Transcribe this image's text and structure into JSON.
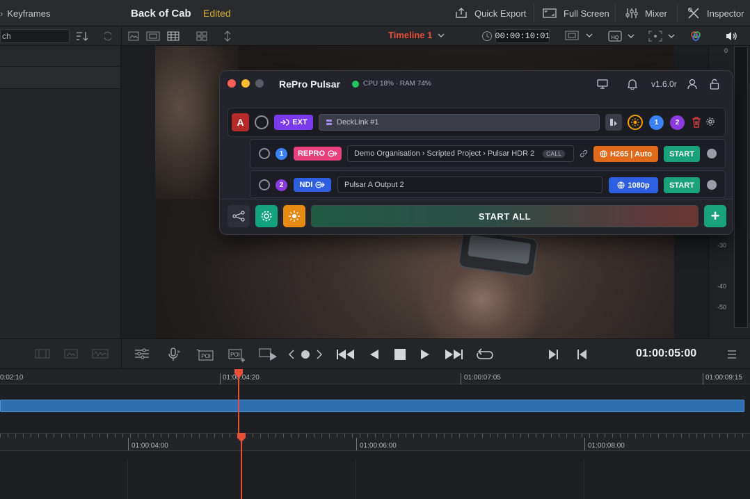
{
  "topbar": {
    "keyframes": "Keyframes",
    "project_title": "Back of Cab",
    "edited": "Edited",
    "quick_export": "Quick Export",
    "full_screen": "Full Screen",
    "mixer": "Mixer",
    "inspector": "Inspector"
  },
  "toolbar2": {
    "search_placeholder": "ch",
    "timeline_name": "Timeline 1",
    "timecode": "00:00:10:01"
  },
  "meter": {
    "ticks": [
      "0",
      "-30",
      "-40",
      "-50"
    ]
  },
  "pulsar": {
    "title": "RePro Pulsar",
    "status": "CPU 18% · RAM 74%",
    "version": "v1.6.0r",
    "source": {
      "badge": "A",
      "type": "EXT",
      "device": "DeckLink #1",
      "output_badges": [
        "1",
        "2"
      ]
    },
    "outputs": [
      {
        "num": "1",
        "type": "REPRO",
        "path": "Demo Organisation › Scripted Project › Pulsar HDR 2",
        "tag": "CALL",
        "codec": "H265 | Auto",
        "start": "START"
      },
      {
        "num": "2",
        "type": "NDI",
        "path": "Pulsar A Output 2",
        "codec": "1080p",
        "start": "START"
      }
    ],
    "start_all": "START ALL",
    "add": "+"
  },
  "transport": {
    "timecode": "01:00:05:00"
  },
  "timeline": {
    "ruler1": [
      "0:02:10",
      "01:00:04:20",
      "01:00:07:05",
      "01:00:09:15"
    ],
    "ruler2": [
      "01:00:04:00",
      "01:00:06:00",
      "01:00:08:00"
    ]
  },
  "colors": {
    "accent_red": "#e8503a",
    "clip_blue": "#2d6fb0",
    "edited_yellow": "#d6b23a",
    "start_green": "#1aa37a",
    "repro_pink": "#e8407a",
    "ndi_blue": "#2d5fe0",
    "ext_purple": "#7c3aed",
    "codec_orange": "#e06a1a"
  }
}
